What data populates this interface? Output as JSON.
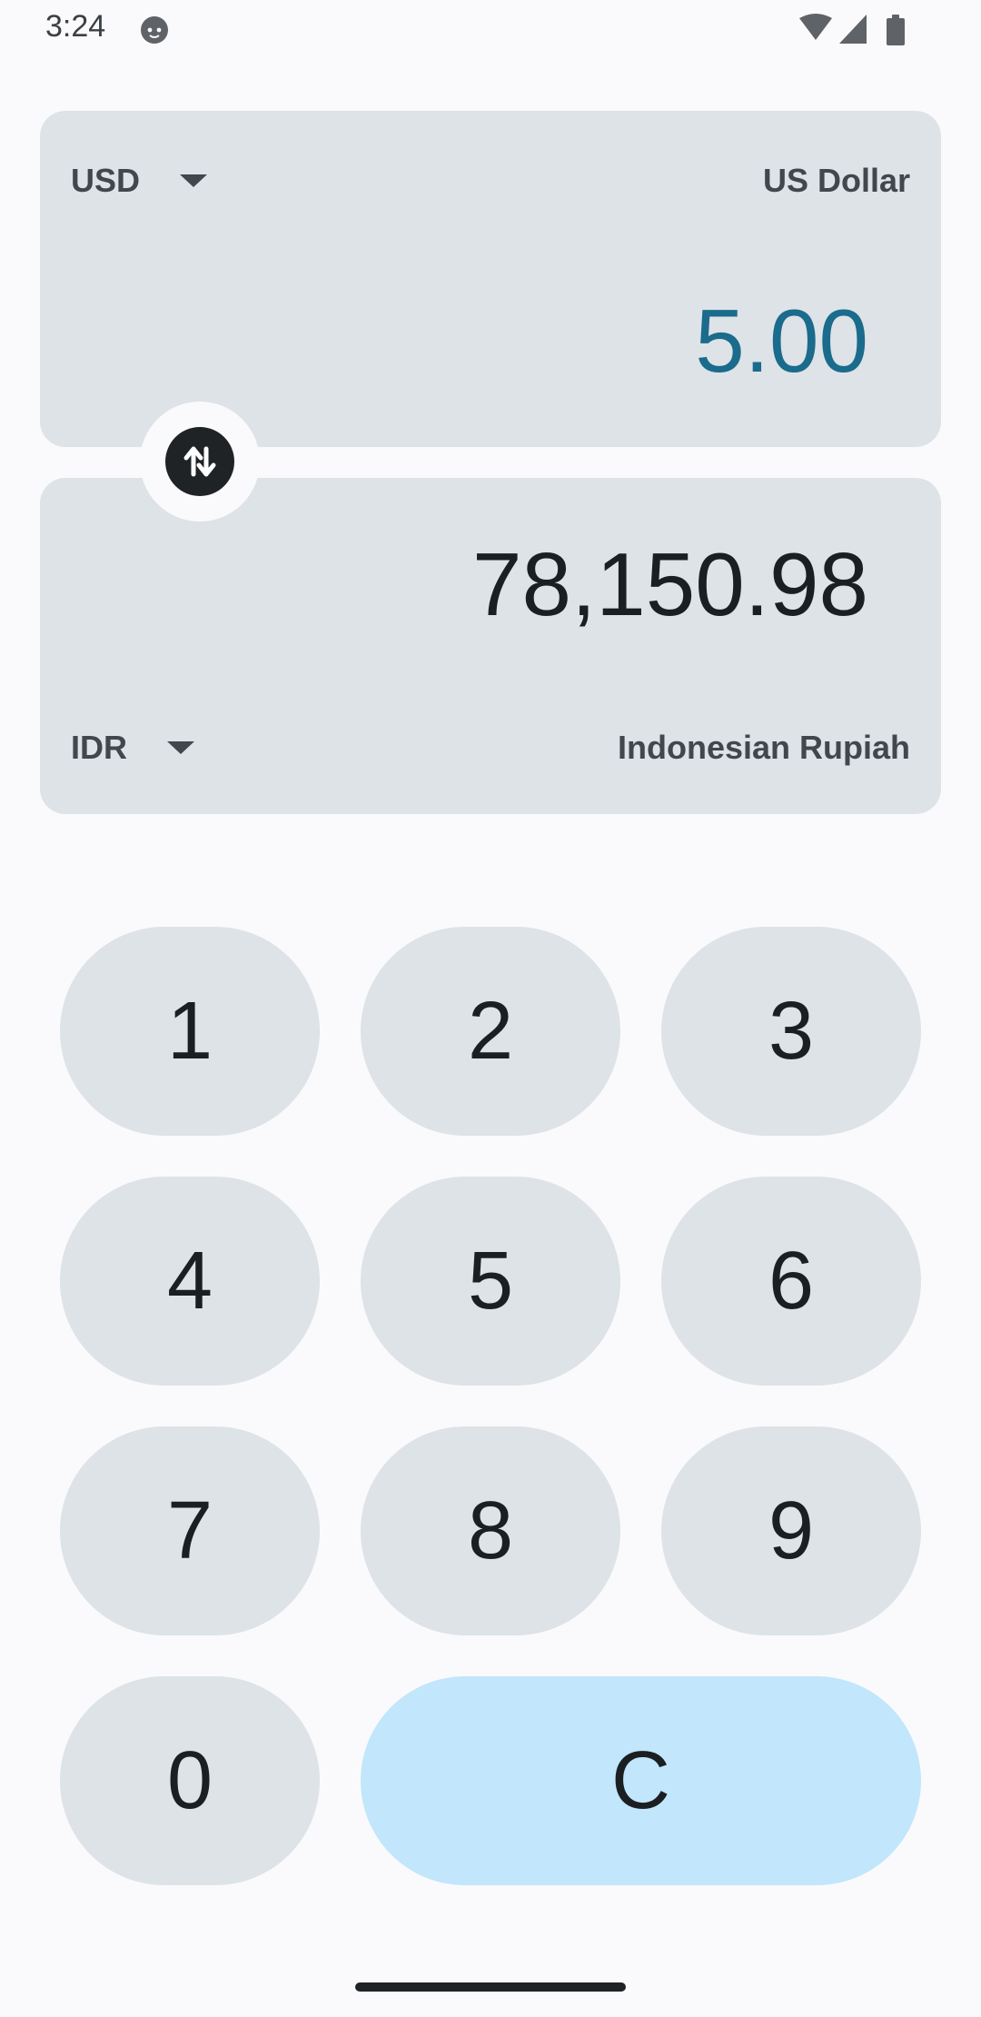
{
  "status_bar": {
    "time": "3:24",
    "icons": [
      "cat-notification-icon",
      "wifi-icon",
      "cellular-signal-icon",
      "battery-icon"
    ]
  },
  "from_currency": {
    "code": "USD",
    "name": "US Dollar",
    "amount": "5.00"
  },
  "to_currency": {
    "code": "IDR",
    "name": "Indonesian Rupiah",
    "amount": "78,150.98"
  },
  "swap": {
    "icon": "swap-vertical-icon"
  },
  "keypad": {
    "keys": [
      "1",
      "2",
      "3",
      "4",
      "5",
      "6",
      "7",
      "8",
      "9",
      "0"
    ],
    "clear_label": "C"
  },
  "colors": {
    "background": "#FAFAFC",
    "card": "#DDE3E7",
    "active_amount": "#1A6B8C",
    "clear_key": "#C2E6FB",
    "text": "#1B1F22"
  }
}
